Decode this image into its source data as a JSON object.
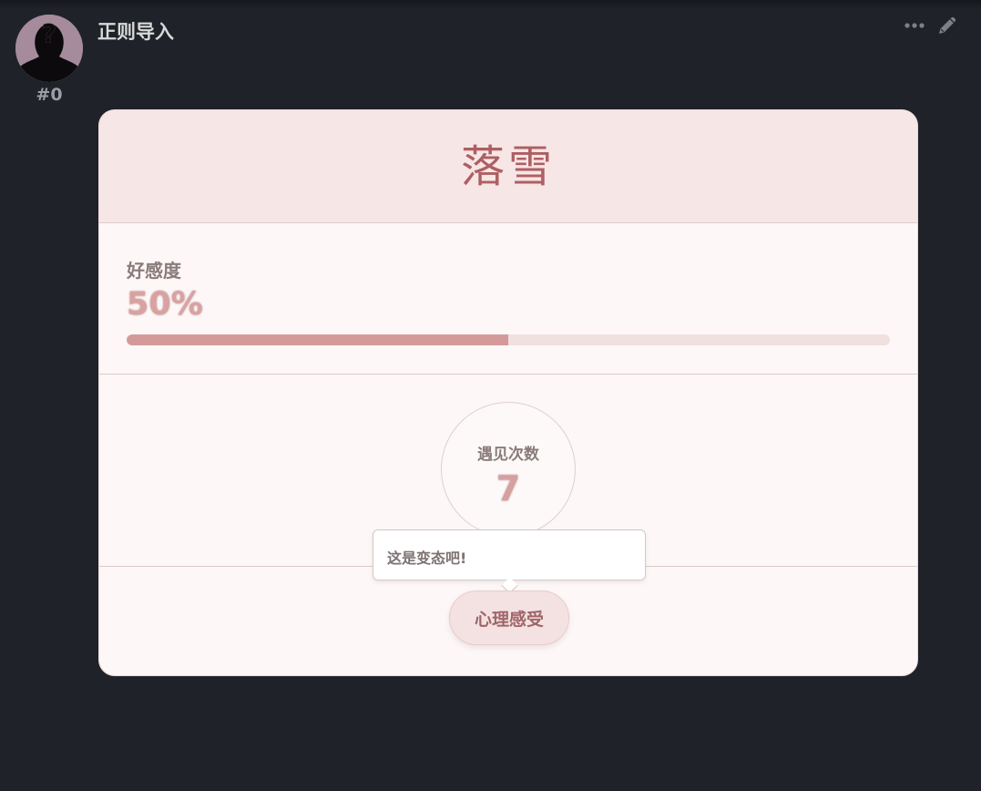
{
  "message": {
    "avatar_icon": "mystery-silhouette",
    "index": "#0",
    "character_name": "正则导入",
    "actions": [
      {
        "name": "more",
        "icon": "ellipsis-icon"
      },
      {
        "name": "edit",
        "icon": "pencil-icon"
      }
    ]
  },
  "card": {
    "title": "落雪",
    "favor": {
      "label": "好感度",
      "value": "50%",
      "fraction": 0.5
    },
    "encounter": {
      "label": "遇见次数",
      "value": "7"
    },
    "tooltip": {
      "text": "这是变态吧!"
    },
    "feel_button": {
      "label": "心理感受"
    }
  },
  "colors": {
    "page_background": "#1f2229",
    "card_background": "#fdf7f7",
    "header_background": "#f7e6e6",
    "accent": "#ae5f63",
    "progress_fill": "#d49a9a",
    "progress_track": "#f1e0e0"
  }
}
